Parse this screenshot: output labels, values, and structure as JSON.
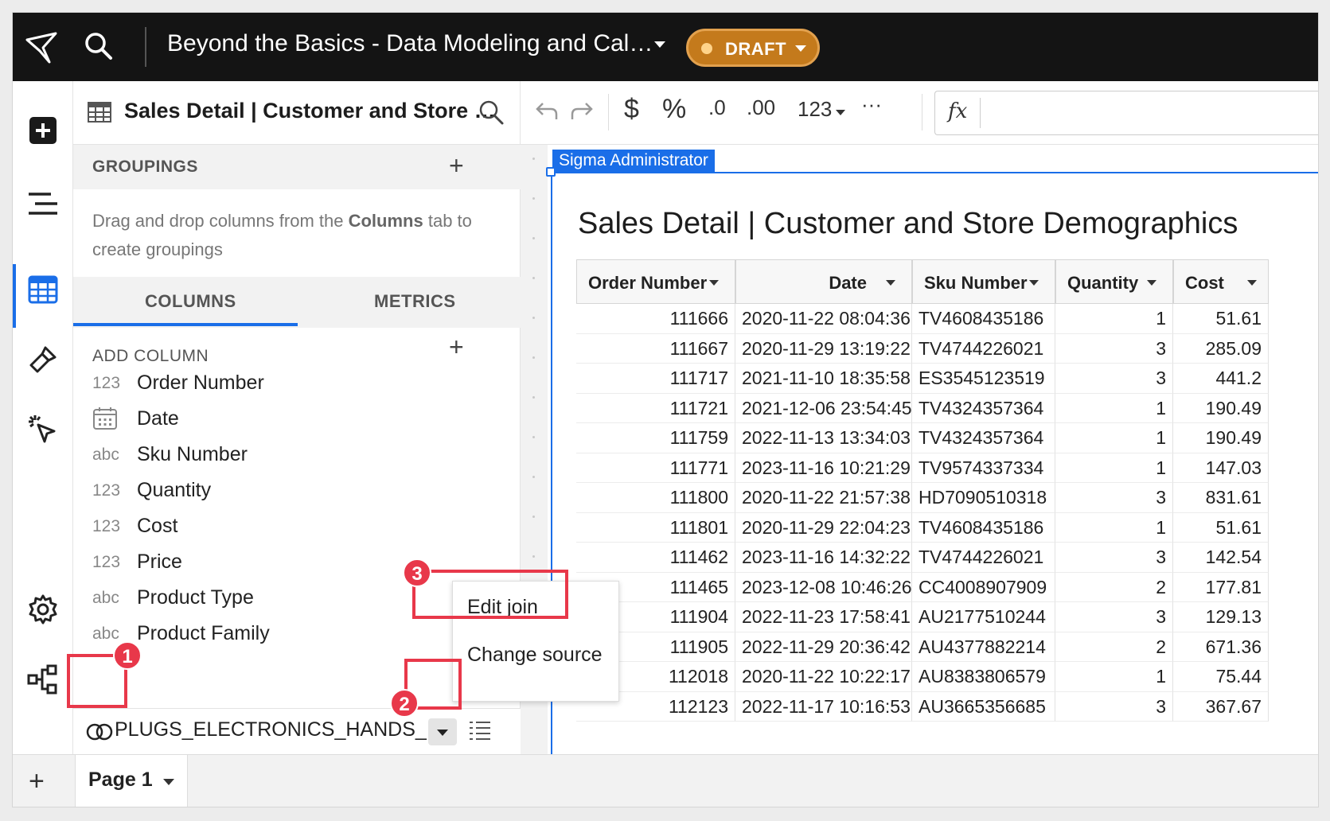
{
  "topbar": {
    "title": "Beyond the Basics - Data Modeling and Cal…",
    "status": "DRAFT"
  },
  "rail": {
    "icons": [
      "add-icon",
      "outline-icon",
      "table-icon",
      "brush-icon",
      "pointer-click-icon",
      "settings-icon",
      "lineage-icon"
    ]
  },
  "panel": {
    "title": "Sales Detail | Customer and Store …",
    "groupings_label": "GROUPINGS",
    "groupings_help_pre": "Drag and drop columns from the ",
    "groupings_help_bold": "Columns",
    "groupings_help_post": " tab to create groupings",
    "tab_columns": "COLUMNS",
    "tab_metrics": "METRICS",
    "add_column": "ADD COLUMN",
    "columns": [
      {
        "type": "123",
        "name": "Order Number"
      },
      {
        "type": "date",
        "name": "Date"
      },
      {
        "type": "abc",
        "name": "Sku Number"
      },
      {
        "type": "123",
        "name": "Quantity"
      },
      {
        "type": "123",
        "name": "Cost"
      },
      {
        "type": "123",
        "name": "Price"
      },
      {
        "type": "abc",
        "name": "Product Type"
      },
      {
        "type": "abc",
        "name": "Product Family"
      }
    ],
    "source_name": "PLUGS_ELECTRONICS_HANDS_…"
  },
  "toolbar": {
    "currency": "$",
    "percent": "%",
    "dec_less": ".0",
    "dec_more": ".00",
    "number_format": "123",
    "more": "···",
    "fx": "fx"
  },
  "element": {
    "badge": "Sigma Administrator",
    "title": "Sales Detail | Customer and Store Demographics"
  },
  "table": {
    "headers": [
      "Order Number",
      "Date",
      "Sku Number",
      "Quantity",
      "Cost"
    ],
    "rows": [
      [
        "111666",
        "2020-11-22 08:04:36",
        "TV4608435186",
        "1",
        "51.61"
      ],
      [
        "111667",
        "2020-11-29 13:19:22",
        "TV4744226021",
        "3",
        "285.09"
      ],
      [
        "111717",
        "2021-11-10 18:35:58",
        "ES3545123519",
        "3",
        "441.2"
      ],
      [
        "111721",
        "2021-12-06 23:54:45",
        "TV4324357364",
        "1",
        "190.49"
      ],
      [
        "111759",
        "2022-11-13 13:34:03",
        "TV4324357364",
        "1",
        "190.49"
      ],
      [
        "111771",
        "2023-11-16 10:21:29",
        "TV9574337334",
        "1",
        "147.03"
      ],
      [
        "111800",
        "2020-11-22 21:57:38",
        "HD7090510318",
        "3",
        "831.61"
      ],
      [
        "111801",
        "2020-11-29 22:04:23",
        "TV4608435186",
        "1",
        "51.61"
      ],
      [
        "111462",
        "2023-11-16 14:32:22",
        "TV4744226021",
        "3",
        "142.54"
      ],
      [
        "111465",
        "2023-12-08 10:46:26",
        "CC4008907909",
        "2",
        "177.81"
      ],
      [
        "111904",
        "2022-11-23 17:58:41",
        "AU2177510244",
        "3",
        "129.13"
      ],
      [
        "111905",
        "2022-11-29 20:36:42",
        "AU4377882214",
        "2",
        "671.36"
      ],
      [
        "112018",
        "2020-11-22 10:22:17",
        "AU8383806579",
        "1",
        "75.44"
      ],
      [
        "112123",
        "2022-11-17 10:16:53",
        "AU3665356685",
        "3",
        "367.67"
      ]
    ]
  },
  "popup": {
    "edit_join": "Edit join",
    "change_source": "Change source"
  },
  "annotations": [
    "1",
    "2",
    "3"
  ],
  "bottom": {
    "page_tab": "Page 1"
  },
  "colors": {
    "accent": "#1a6ee8",
    "draft": "#c47a1c",
    "annotation": "#e8384a",
    "topbar": "#141414"
  }
}
